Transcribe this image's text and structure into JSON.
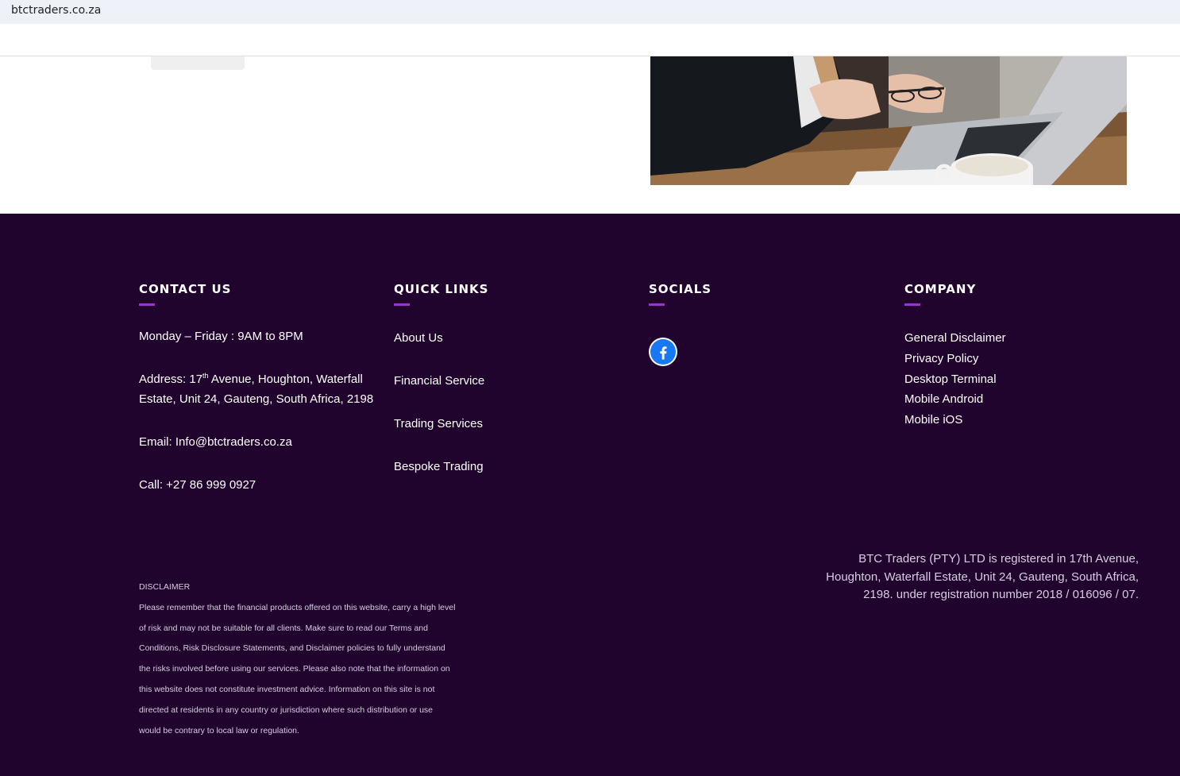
{
  "browser": {
    "url": "btctraders.co.za"
  },
  "footer": {
    "contact": {
      "heading": "CONTACT US",
      "hours": "Monday – Friday : 9AM to 8PM",
      "address_prefix": "Address: 17",
      "address_sup": "th",
      "address_rest": " Avenue, Houghton, Waterfall Estate, Unit 24, Gauteng, South Africa, 2198",
      "email": "Email: Info@btctraders.co.za",
      "phone": "Call: +27 86 999 0927"
    },
    "quick_links": {
      "heading": "QUICK LINKS",
      "items": [
        "About Us",
        "Financial Service",
        "Trading Services",
        "Bespoke Trading"
      ]
    },
    "socials": {
      "heading": "SOCIALS",
      "icons": [
        "facebook-icon"
      ],
      "facebook_color": "#1877f2"
    },
    "company": {
      "heading": "COMPANY",
      "items": [
        "General Disclaimer",
        "Privacy Policy",
        "Desktop Terminal",
        "Mobile Android",
        "Mobile iOS"
      ]
    },
    "disclaimer": {
      "title": "DISCLAIMER",
      "text": "Please remember that the financial products offered on this website, carry a high level of risk and may not be suitable for all clients. Make sure to read our Terms and Conditions, Risk Disclosure Statements, and Disclaimer policies to fully understand the risks involved before using our services. Please also note that the information on this website does not constitute investment advice. Information on this site is not directed at residents in any country or jurisdiction where such distribution or use would be contrary to local law or regulation."
    },
    "registration": "BTC Traders (PTY) LTD is registered in 17th Avenue, Houghton, Waterfall Estate, Unit 24, Gauteng, South Africa, 2198. under registration number 2018 / 016096 / 07."
  },
  "colors": {
    "footer_bg": "#21042e",
    "accent": "#9b35c8"
  }
}
